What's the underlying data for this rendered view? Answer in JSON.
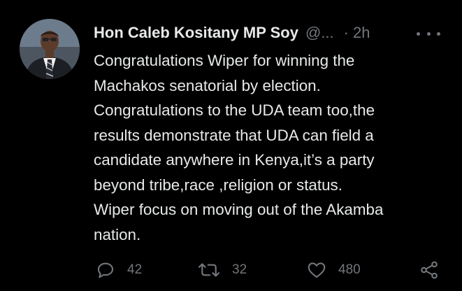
{
  "tweet": {
    "author_name": "Hon Caleb Kositany MP Soy",
    "author_handle": "@...",
    "separator": "·",
    "time": "2h",
    "lines": [
      "Congratulations Wiper for winning the",
      "Machakos senatorial by election.",
      "Congratulations to the UDA team too,the",
      "results demonstrate that UDA can field a",
      "candidate anywhere in Kenya,it’s a party",
      "beyond tribe,race ,religion or status.",
      "Wiper focus on moving out of the Akamba",
      "nation."
    ]
  },
  "actions": {
    "reply_icon": "reply-icon",
    "reply_count": "42",
    "retweet_icon": "retweet-icon",
    "retweet_count": "32",
    "like_icon": "heart-icon",
    "like_count": "480",
    "share_icon": "share-icon"
  },
  "colors": {
    "background": "#000000",
    "text": "#e7e9ea",
    "muted": "#71767b"
  }
}
